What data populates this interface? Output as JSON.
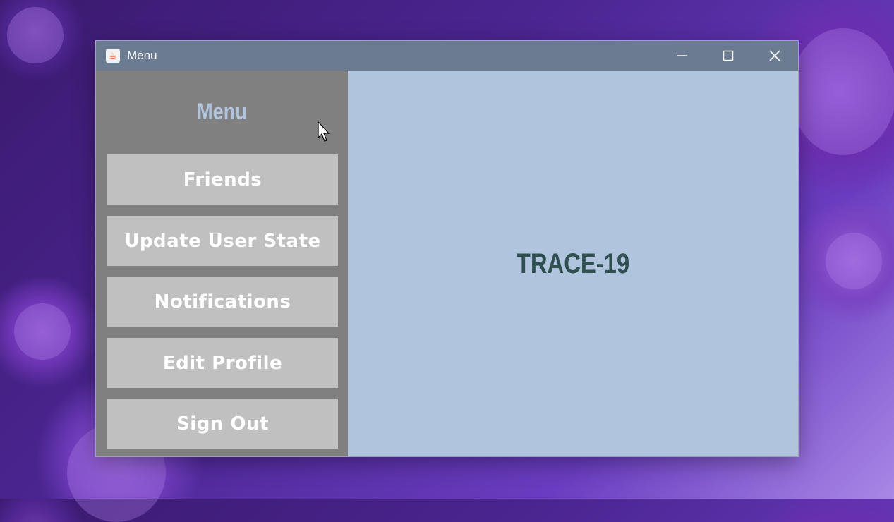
{
  "window": {
    "title": "Menu",
    "app_icon": "java-icon",
    "controls": [
      "minimize-icon",
      "maximize-icon",
      "close-icon"
    ]
  },
  "sidebar": {
    "heading": "Menu",
    "buttons": [
      {
        "label": "Friends"
      },
      {
        "label": "Update User State"
      },
      {
        "label": "Notifications"
      },
      {
        "label": "Edit Profile"
      },
      {
        "label": "Sign Out"
      }
    ]
  },
  "main": {
    "brand": "TRACE-19"
  },
  "colors": {
    "titlebar": "#6b7b91",
    "sidebar": "#808080",
    "button": "#c0c0c0",
    "main": "#b0c4de",
    "heading": "#b0c4de",
    "brand": "#2f4f4f"
  }
}
